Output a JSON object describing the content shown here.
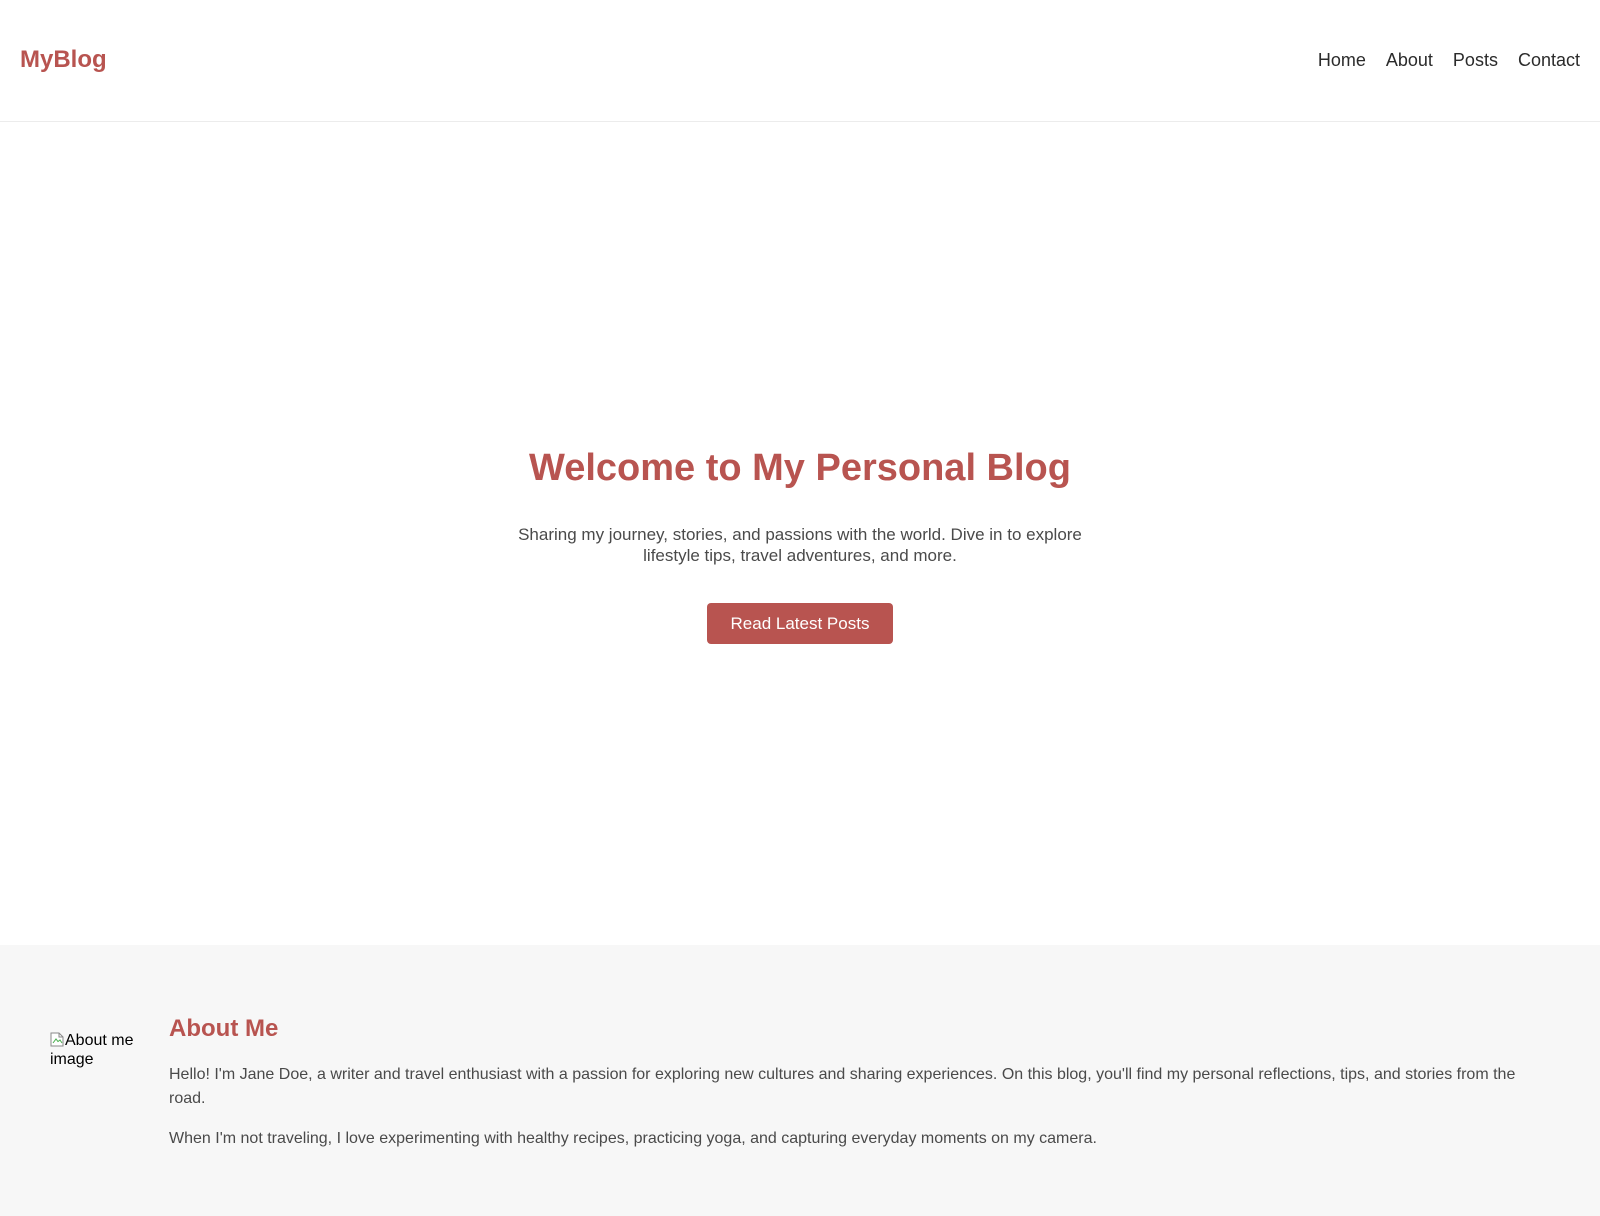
{
  "header": {
    "logo": "MyBlog",
    "nav": [
      "Home",
      "About",
      "Posts",
      "Contact"
    ]
  },
  "hero": {
    "title": "Welcome to My Personal Blog",
    "subtitle": "Sharing my journey, stories, and passions with the world. Dive in to explore lifestyle tips, travel adventures, and more.",
    "button_label": "Read Latest Posts"
  },
  "about": {
    "image_alt": "About me image",
    "title": "About Me",
    "paragraphs": [
      "Hello! I'm Jane Doe, a writer and travel enthusiast with a passion for exploring new cultures and sharing experiences. On this blog, you'll find my personal reflections, tips, and stories from the road.",
      "When I'm not traveling, I love experimenting with healthy recipes, practicing yoga, and capturing everyday moments on my camera."
    ]
  },
  "colors": {
    "accent": "#b85450",
    "text_dark": "#2b2b2b",
    "text_muted": "#4a4a4a",
    "about_background": "#f7f7f7"
  },
  "icons": {
    "broken_image": "broken-image-icon"
  }
}
